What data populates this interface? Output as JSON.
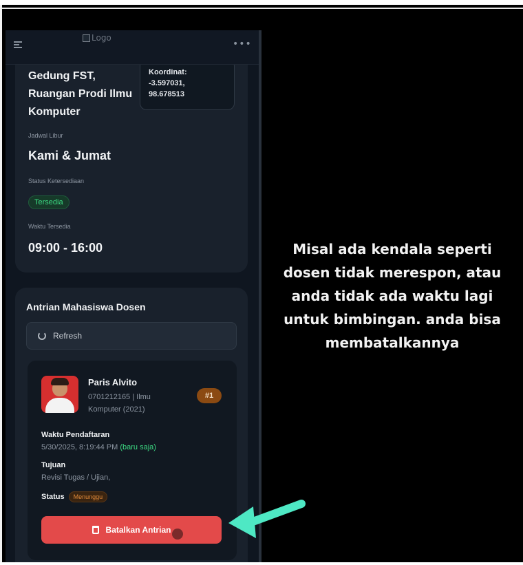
{
  "topbar": {
    "logo_alt": "Logo"
  },
  "info": {
    "location": "Gedung FST, Ruangan Prodi Ilmu Komputer",
    "coordinate_label": "Koordinat:",
    "coordinate_lat": "-3.597031,",
    "coordinate_lng": "98.678513",
    "holiday_label": "Jadwal Libur",
    "holiday_value": "Kami & Jumat",
    "availability_label": "Status Ketersediaan",
    "availability_value": "Tersedia",
    "time_label": "Waktu Tersedia",
    "time_value": "09:00 - 16:00"
  },
  "queue": {
    "title": "Antrian Mahasiswa Dosen",
    "refresh_label": "Refresh",
    "student_name": "Paris Alvito",
    "student_meta": "0701212165 | Ilmu Komputer (2021)",
    "queue_number": "#1",
    "registered_label": "Waktu Pendaftaran",
    "registered_value": "5/30/2025, 8:19:44 PM",
    "registered_ago": "(baru saja)",
    "purpose_label": "Tujuan",
    "purpose_value": "Revisi Tugas / Ujian,",
    "status_label": "Status",
    "status_value": "Menunggu",
    "cancel_label": "Batalkan Antrian"
  },
  "caption": "Misal ada kendala seperti dosen tidak merespon, atau anda tidak ada waktu lagi untuk bimbingan. anda bisa membatalkannya",
  "colors": {
    "accent_green": "#3ddc84",
    "danger": "#e34a4a",
    "arrow": "#4ee8c4",
    "warning": "#e08a3a"
  }
}
